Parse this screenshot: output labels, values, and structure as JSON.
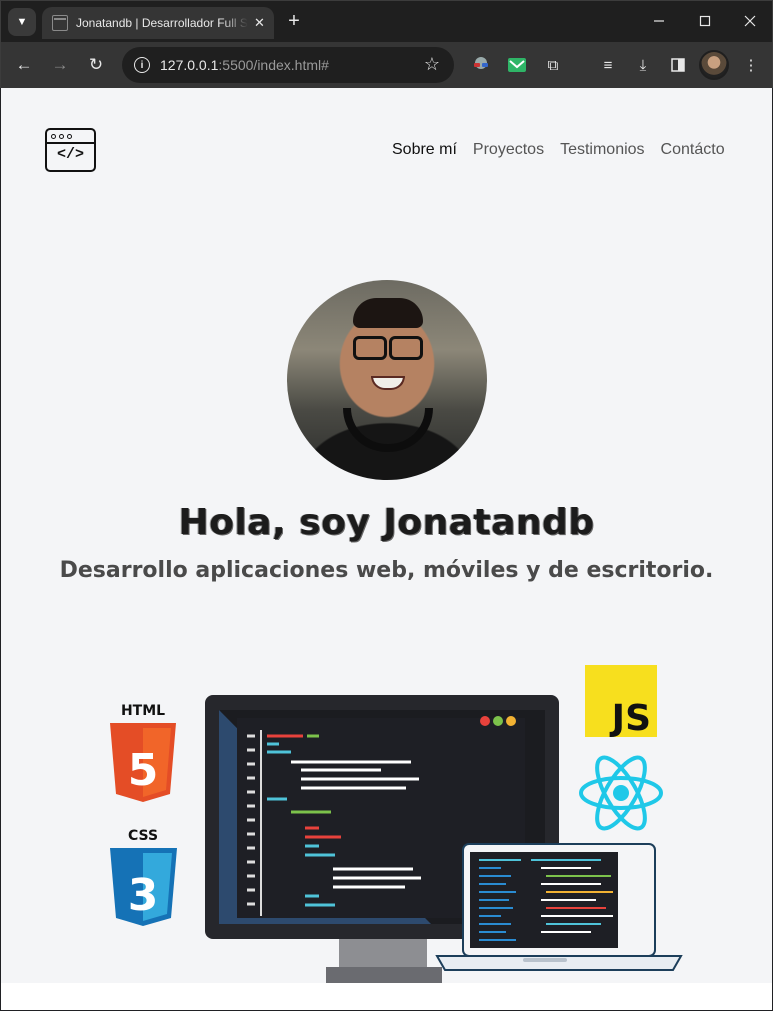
{
  "browser": {
    "tab_title": "Jonatandb | Desarrollador Full Stack",
    "tab_close": "✕",
    "new_tab": "+",
    "url_host": "127.0.0.1",
    "url_path": ":5500/index.html#"
  },
  "nav": {
    "items": [
      "Sobre mí",
      "Proyectos",
      "Testimonios",
      "Contácto"
    ],
    "active": "Sobre mí"
  },
  "hero": {
    "title": "Hola, soy Jonatandb",
    "subtitle": "Desarrollo aplicaciones web, móviles y de escritorio."
  },
  "tech_badges": {
    "html": "HTML",
    "css": "CSS",
    "js": "JS",
    "html_digit": "5",
    "css_digit": "3"
  },
  "logo_code": "</>",
  "colors": {
    "page_bg": "#f4f5f7",
    "html_orange": "#e44d26",
    "css_blue": "#2965f1",
    "js_yellow": "#f7df1e",
    "react_cyan": "#1fc8e8"
  }
}
